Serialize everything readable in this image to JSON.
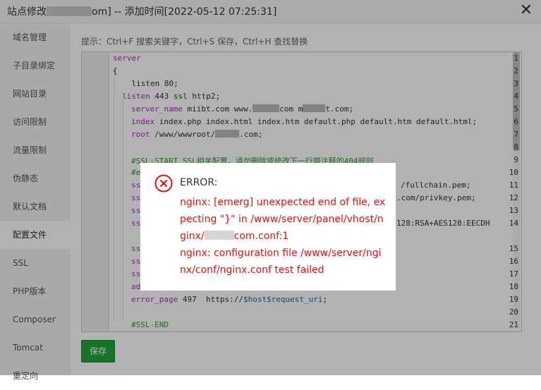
{
  "window": {
    "title_prefix": "站点修改",
    "title_suffix": "om] -- 添加时间[2022-05-12 07:25:31]",
    "close_icon": "close-icon"
  },
  "sidebar": {
    "items": [
      {
        "label": "域名管理"
      },
      {
        "label": "子目录绑定"
      },
      {
        "label": "网站目录"
      },
      {
        "label": "访问限制"
      },
      {
        "label": "流量限制"
      },
      {
        "label": "伪静态"
      },
      {
        "label": "默认文档"
      },
      {
        "label": "配置文件",
        "active": true
      },
      {
        "label": "SSL"
      },
      {
        "label": "PHP版本"
      },
      {
        "label": "Composer"
      },
      {
        "label": "Tomcat"
      },
      {
        "label": "重定向"
      }
    ]
  },
  "tip": "提示：Ctrl+F 搜索关键字，Ctrl+S 保存，Ctrl+H 查找替换",
  "editor": {
    "line_numbers": [
      "1",
      "2",
      "3",
      "4",
      "5",
      "6",
      "7",
      "8",
      "9",
      "10",
      "11",
      "12",
      "13",
      "14",
      "",
      "15",
      "16",
      "17",
      "18",
      "19",
      "20",
      "21"
    ],
    "lines": {
      "l1": "server",
      "l2": "{",
      "l3": "    listen 80;",
      "l4_kw": "listen",
      "l4_rest": " 443 ssl http2;",
      "l5_kw": "server_name",
      "l5_a": " miibt.com www.",
      "l5_b": "com m",
      "l5_c": "t.com;",
      "l6_kw": "index",
      "l6_rest": " index.php index.html index.htm default.php default.htm default.html;",
      "l7_kw": "root",
      "l7_a": " /www/wwwroot/",
      "l7_b": ".com;",
      "l9": "#SSL-START SSL相关配置，请勿删除或修改下一行带注释的404规则",
      "l10": "#e",
      "l11_a": "ss",
      "l11_b": "/fullchain.pem;",
      "l12_a": "ss",
      "l12_b": ".com/privkey.pem;",
      "l13_a": "ss",
      "l14_a": "ss",
      "l14_b": "128:RSA+AES128:EECDH",
      "l15_a": "ss",
      "l16_a": "ss",
      "l17_a": "ss",
      "l18_a": "ad",
      "l19_kw": "error_page",
      "l19_a": " 497  https://",
      "l19_var": "$host$request_uri",
      "l19_b": ";",
      "l21": "#SSL-END"
    }
  },
  "save_button": "保存",
  "dialog": {
    "title": "ERROR:",
    "msg_line1": "nginx: [emerg] unexpected end of file, expecting \"}\" in /www/server/panel/vhost/nginx/",
    "msg_line1_tail": "com.conf:1",
    "msg_line2": "nginx: configuration file /www/server/nginx/conf/nginx.conf test failed",
    "icon": "error-x-icon"
  }
}
